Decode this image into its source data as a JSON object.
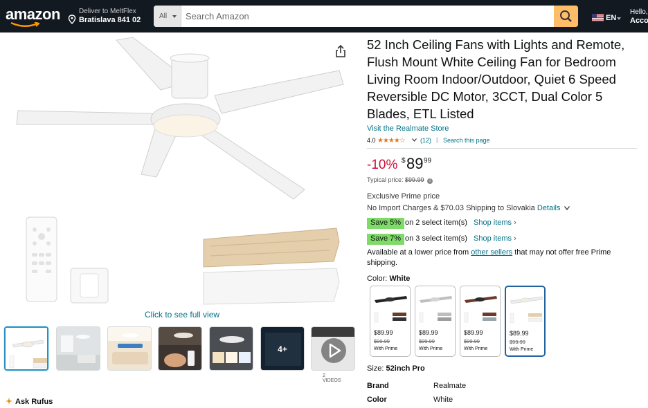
{
  "header": {
    "logo": "amazon",
    "deliver_line1": "Deliver to MeltFlex",
    "deliver_line2": "Bratislava 841 02",
    "search_category": "All",
    "search_placeholder": "Search Amazon",
    "language": "EN",
    "account_line1": "Hello,",
    "account_line2": "Acco"
  },
  "gallery": {
    "see_full_view": "Click to see full view",
    "more_label": "4+",
    "videos_label": "2 VIDEOS",
    "thumbnails": [
      "main-fan",
      "room-scene",
      "speed-adjust",
      "remote-in-hand",
      "light-colors",
      "more-images",
      "video"
    ]
  },
  "product": {
    "title": "52 Inch Ceiling Fans with Lights and Remote, Flush Mount White Ceiling Fan for Bedroom Living Room Indoor/Outdoor, Quiet 6 Speed Reversible DC Motor, 3CCT, Dual Color 5 Blades, ETL Listed",
    "store_link": "Visit the Realmate Store",
    "rating": "4.0",
    "stars": "★★★★☆",
    "review_count": "(12)",
    "search_page": "Search this page",
    "discount": "-10%",
    "price_currency": "$",
    "price_whole": "89",
    "price_fraction": "99",
    "typical_label": "Typical price:",
    "typical_price": "$99.99",
    "exclusive": "Exclusive Prime price",
    "shipping": "No Import Charges & $70.03 Shipping to Slovakia",
    "details_link": "Details",
    "save_offers": [
      {
        "badge": "Save 5%",
        "text": "on 2 select item(s)",
        "link": "Shop items ›"
      },
      {
        "badge": "Save 7%",
        "text": "on 3 select item(s)",
        "link": "Shop items ›"
      }
    ],
    "lower_price_prefix": "Available at a lower price from",
    "lower_price_link": "other sellers",
    "lower_price_suffix": "that may not offer free Prime shipping.",
    "color_label": "Color:",
    "color_value": "White",
    "swatches": [
      {
        "name": "black",
        "price": "$89.99",
        "old": "$99.99",
        "prime": "With Prime"
      },
      {
        "name": "silver",
        "price": "$89.99",
        "old": "$99.99",
        "prime": "With Prime"
      },
      {
        "name": "brown",
        "price": "$89.99",
        "old": "$99.99",
        "prime": "With Prime"
      },
      {
        "name": "white",
        "price": "$89.99",
        "old": "$99.99",
        "prime": "With Prime"
      }
    ],
    "size_label": "Size:",
    "size_value": "52inch Pro",
    "specs": [
      {
        "key": "Brand",
        "value": "Realmate"
      },
      {
        "key": "Color",
        "value": "White"
      }
    ]
  },
  "rufus": {
    "label": "Ask Rufus"
  },
  "colors": {
    "header_bg": "#131921",
    "search_button": "#febd69",
    "link": "#007185",
    "discount": "#cc0c39",
    "save_badge": "#7fda69",
    "star": "#de7921"
  }
}
